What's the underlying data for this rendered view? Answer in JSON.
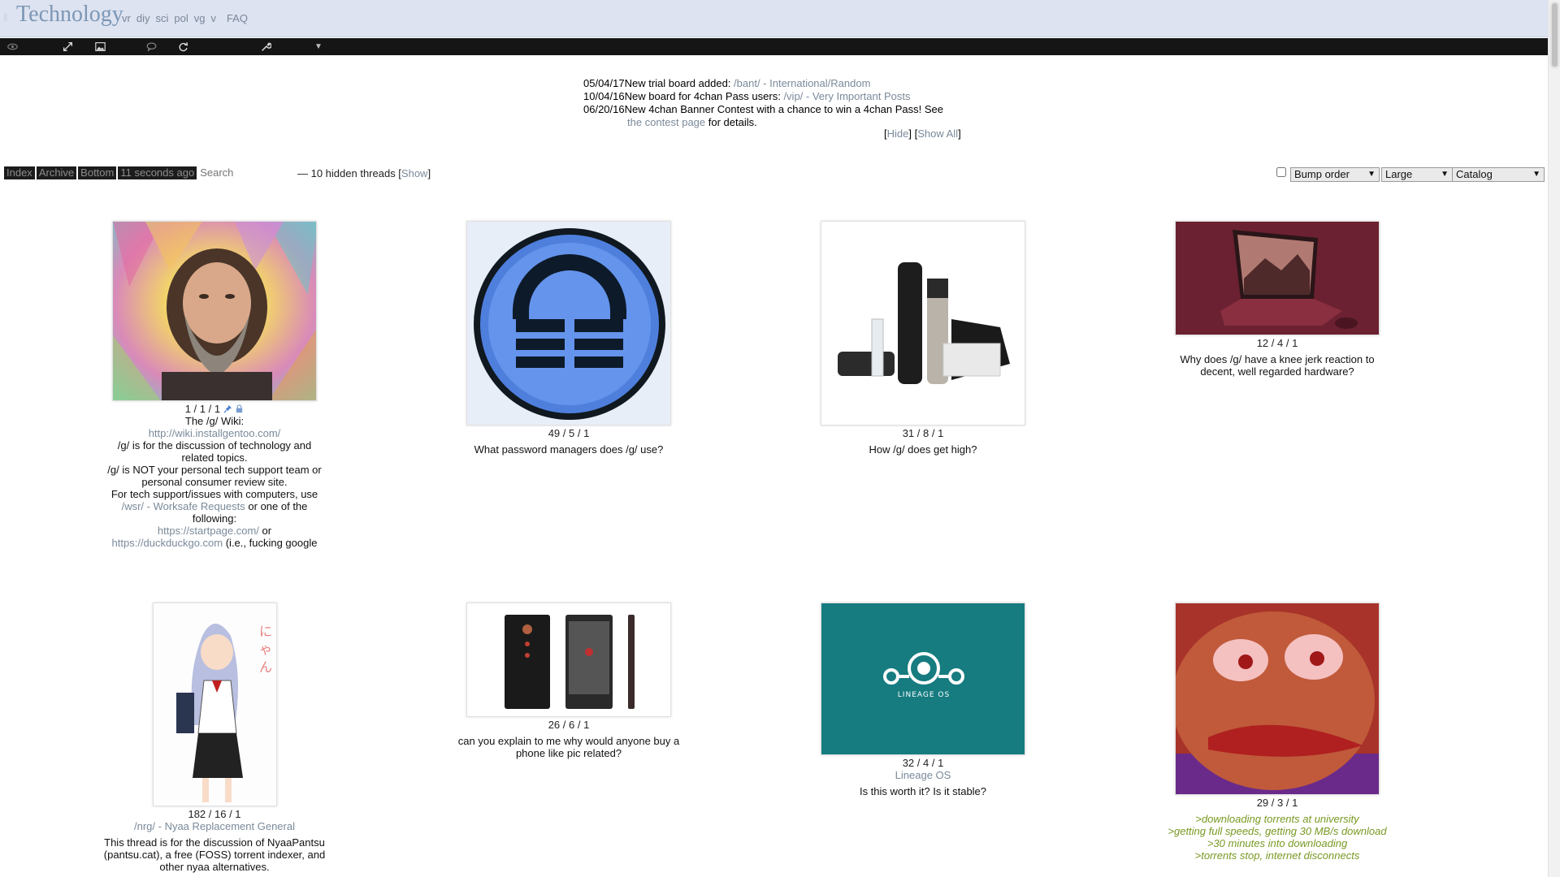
{
  "header": {
    "board_title": "Technology",
    "nav_links": [
      "vr",
      "diy",
      "sci",
      "pol",
      "vg",
      "v"
    ],
    "faq_label": "FAQ"
  },
  "toolbar": {
    "icons": [
      "eye-icon",
      "expand-icon",
      "image-icon",
      "speech-bubble-icon",
      "refresh-icon",
      "wrench-icon",
      "dropdown-arrow-icon"
    ]
  },
  "announcements": {
    "items": [
      {
        "date": "05/04/17",
        "text": "New trial board added: ",
        "link": "/bant/ - International/Random"
      },
      {
        "date": "10/04/16",
        "text": "New board for 4chan Pass users: ",
        "link": "/vip/ - Very Important Posts"
      },
      {
        "date": "06/20/16",
        "text": "New 4chan Banner Contest with a chance to win a 4chan Pass! See",
        "link": "the contest page",
        "after": " for details."
      }
    ],
    "hide_label": "Hide",
    "show_all_label": "Show All"
  },
  "catalog_nav": {
    "index_label": "Index",
    "archive_label": "Archive",
    "bottom_label": "Bottom",
    "refresh_label": "11 seconds ago",
    "search_placeholder": "Search",
    "hidden_text": "— 10 hidden threads [",
    "show_label": "Show",
    "hidden_close": "]"
  },
  "sort": {
    "order_selected": "Bump order",
    "size_selected": "Large",
    "mode_selected": "Catalog"
  },
  "threads": [
    {
      "stats": "1 / 1 / 1",
      "teaser_title": "The /g/ Wiki:",
      "wiki_link": "http://wiki.installgentoo.com/",
      "line1": "/g/ is for the discussion of technology and related topics.",
      "line2": "/g/ is NOT your personal tech support team or personal consumer review site.",
      "line3": "For tech support/issues with computers, use",
      "wsr_link": "/wsr/ - Worksafe Requests",
      "line4": " or one of the following:",
      "startpage_link": "https://startpage.com/",
      "or_text": " or",
      "ddg_link": "https://duckduckgo.com",
      "line5": " (i.e., fucking google"
    },
    {
      "stats": "49 / 5 / 1",
      "teaser": "What password managers does /g/ use?"
    },
    {
      "stats": "31 / 8 / 1",
      "teaser": "How /g/ does get high?"
    },
    {
      "stats": "12 / 4 / 1",
      "teaser": "Why does /g/ have a knee jerk reaction to decent, well regarded hardware?"
    },
    {
      "stats": "182 / 16 / 1",
      "subject": "/nrg/ - Nyaa Replacement General",
      "teaser": "This thread is for the discussion of NyaaPantsu (pantsu.cat), a free (FOSS) torrent indexer, and other nyaa alternatives."
    },
    {
      "stats": "26 / 6 / 1",
      "teaser": "can you explain to me why would anyone buy a phone like pic related?"
    },
    {
      "stats": "32 / 4 / 1",
      "subject": "Lineage OS",
      "teaser": "Is this worth it? Is it stable?",
      "logo_text": "LINEAGE OS"
    },
    {
      "stats": "29 / 3 / 1",
      "greentext": [
        ">downloading torrents at university",
        ">getting full speeds, getting 30 MB/s download",
        ">30 minutes into downloading",
        ">torrents stop, internet disconnects"
      ]
    }
  ],
  "colors": {
    "header_bg": "#dde3f0",
    "toolbar_bg": "#151515",
    "link": "#7a8a9a",
    "greentext": "#789922",
    "lineage_teal": "#167c80"
  }
}
